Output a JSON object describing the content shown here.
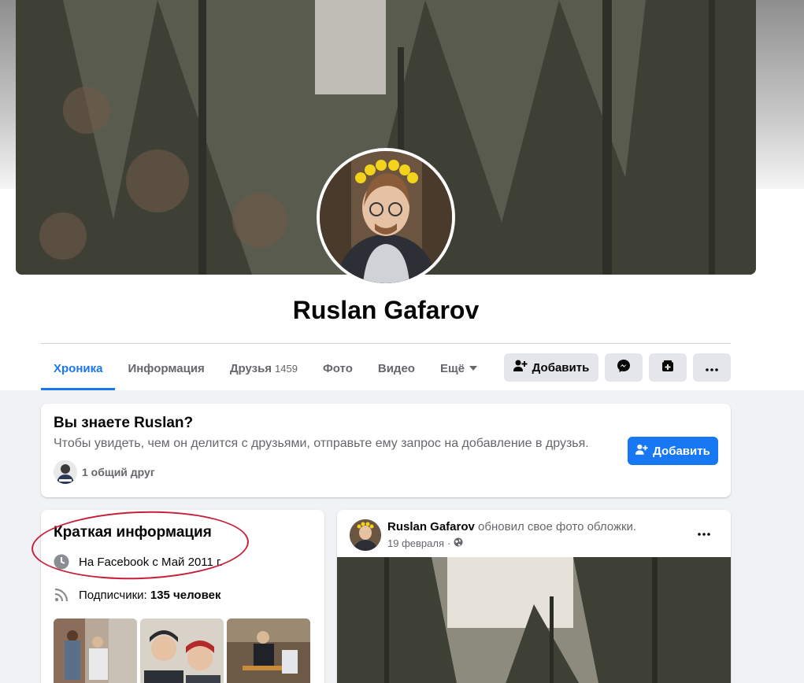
{
  "profile": {
    "name": "Ruslan Gafarov"
  },
  "tabs": [
    {
      "label": "Хроника",
      "active": true
    },
    {
      "label": "Информация"
    },
    {
      "label": "Друзья",
      "count": "1459"
    },
    {
      "label": "Фото"
    },
    {
      "label": "Видео"
    },
    {
      "label": "Ещё"
    }
  ],
  "actions": {
    "add_label": "Добавить"
  },
  "know_card": {
    "title": "Вы знаете Ruslan?",
    "description": "Чтобы увидеть, чем он делится с друзьями, отправьте ему запрос на добавление в друзья.",
    "mutual": "1 общий друг",
    "add_label": "Добавить"
  },
  "intro": {
    "title": "Краткая информация",
    "joined": "На Facebook с Май 2011 г.",
    "followers_label": "Подписчики: ",
    "followers_value": "135 человек"
  },
  "post": {
    "author": "Ruslan Gafarov",
    "action": " обновил свое фото обложки.",
    "date": "19 февраля",
    "separator": "·"
  },
  "colors": {
    "accent": "#1877f2",
    "highlight": "#c8203a"
  }
}
